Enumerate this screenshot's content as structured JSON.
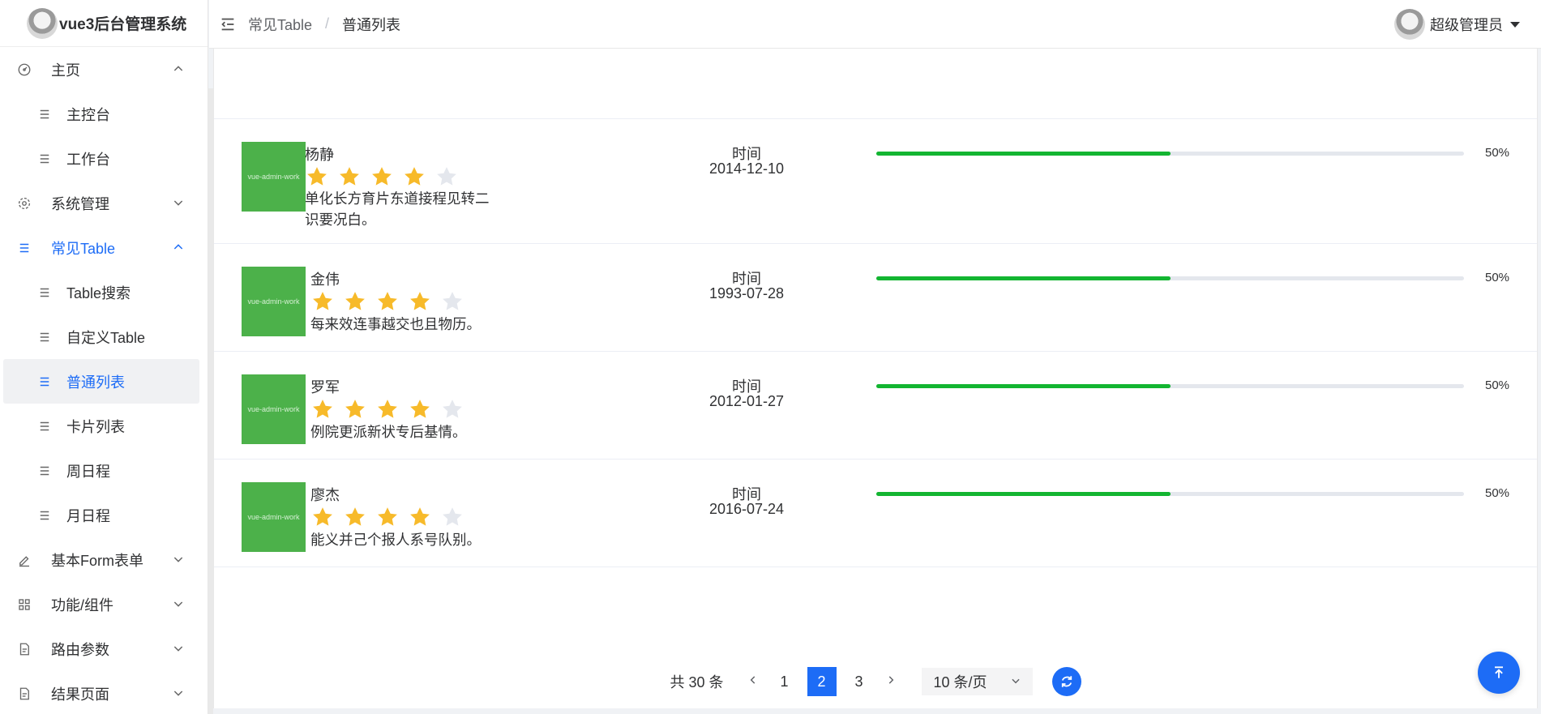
{
  "app": {
    "title": "vue3后台管理系统"
  },
  "sidebar": {
    "items": [
      {
        "label": "主页",
        "level": "top",
        "icon": "dashboard-icon",
        "chevron": "up"
      },
      {
        "label": "主控台",
        "level": "sub",
        "icon": "list-icon"
      },
      {
        "label": "工作台",
        "level": "sub",
        "icon": "list-icon"
      },
      {
        "label": "系统管理",
        "level": "top",
        "icon": "gear-icon",
        "chevron": "down"
      },
      {
        "label": "常见Table",
        "level": "top",
        "icon": "list-icon",
        "chevron": "up",
        "active": true
      },
      {
        "label": "Table搜索",
        "level": "sub",
        "icon": "list-icon"
      },
      {
        "label": "自定义Table",
        "level": "sub",
        "icon": "list-icon"
      },
      {
        "label": "普通列表",
        "level": "sub",
        "icon": "list-icon",
        "selected": true
      },
      {
        "label": "卡片列表",
        "level": "sub",
        "icon": "list-icon"
      },
      {
        "label": "周日程",
        "level": "sub",
        "icon": "list-icon"
      },
      {
        "label": "月日程",
        "level": "sub",
        "icon": "list-icon"
      },
      {
        "label": "基本Form表单",
        "level": "top",
        "icon": "edit-icon",
        "chevron": "down"
      },
      {
        "label": "功能/组件",
        "level": "top",
        "icon": "grid-icon",
        "chevron": "down"
      },
      {
        "label": "路由参数",
        "level": "top",
        "icon": "document-icon",
        "chevron": "down"
      },
      {
        "label": "结果页面",
        "level": "top",
        "icon": "document-icon",
        "chevron": "down"
      }
    ]
  },
  "header": {
    "breadcrumb": [
      "常见Table",
      "普通列表"
    ],
    "user_name": "超级管理员"
  },
  "list": {
    "rows": [
      {
        "thumb_text": "vue-admin-work",
        "name": "杨静",
        "rating": 4,
        "max_rating": 5,
        "description": "单化长方育片东道接程见转二识要况白。",
        "time_label": "时间",
        "date": "2014-12-10",
        "progress": 50,
        "progress_text": "50%"
      },
      {
        "thumb_text": "vue-admin-work",
        "name": "金伟",
        "rating": 4,
        "max_rating": 5,
        "description": "每来效连事越交也且物历。",
        "time_label": "时间",
        "date": "1993-07-28",
        "progress": 50,
        "progress_text": "50%"
      },
      {
        "thumb_text": "vue-admin-work",
        "name": "罗军",
        "rating": 4,
        "max_rating": 5,
        "description": "例院更派新状专后基情。",
        "time_label": "时间",
        "date": "2012-01-27",
        "progress": 50,
        "progress_text": "50%"
      },
      {
        "thumb_text": "vue-admin-work",
        "name": "廖杰",
        "rating": 4,
        "max_rating": 5,
        "description": "能义并己个报人系号队别。",
        "time_label": "时间",
        "date": "2016-07-24",
        "progress": 50,
        "progress_text": "50%"
      }
    ]
  },
  "pagination": {
    "total_text": "共 30 条",
    "pages": [
      "1",
      "2",
      "3"
    ],
    "current_page": "2",
    "page_size": "10 条/页"
  },
  "colors": {
    "accent": "#1d6cf6",
    "thumb": "#4cb14a",
    "progress": "#13b531",
    "star_on": "#f7ba2a",
    "star_off": "#e4e7ed"
  }
}
